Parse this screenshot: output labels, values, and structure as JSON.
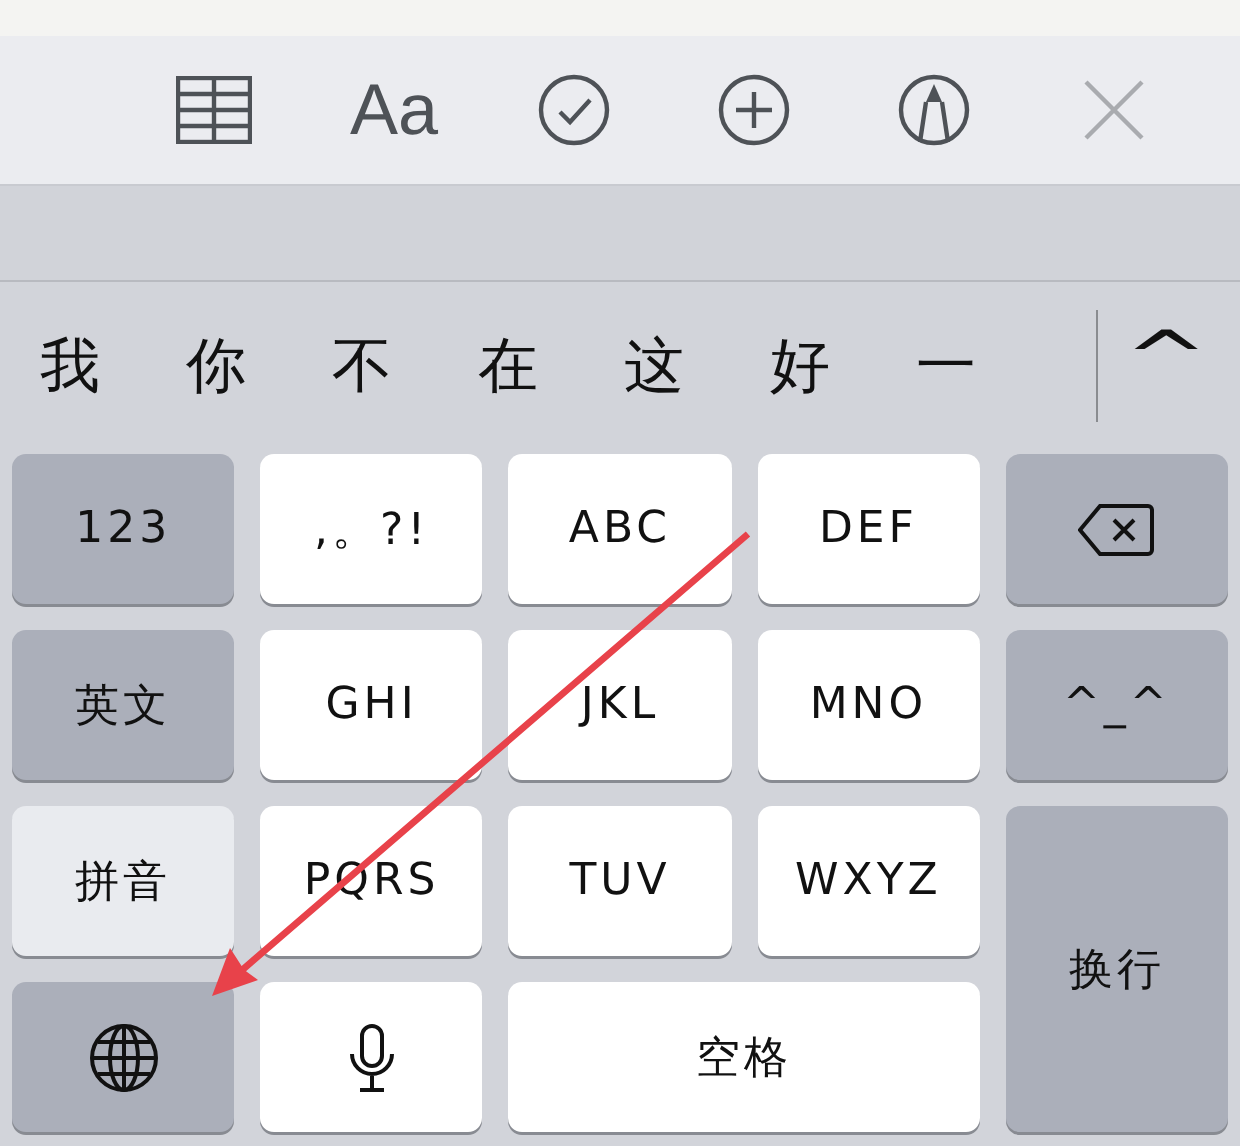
{
  "toolbar": {
    "items": [
      {
        "kind": "table"
      },
      {
        "kind": "text",
        "label": "Aa"
      },
      {
        "kind": "check"
      },
      {
        "kind": "plus"
      },
      {
        "kind": "pen"
      },
      {
        "kind": "close"
      }
    ]
  },
  "candidates": {
    "items": [
      "我",
      "你",
      "不",
      "在",
      "这",
      "好",
      "一"
    ],
    "expand": "^"
  },
  "keys": [
    {
      "kind": "function",
      "label": "123"
    },
    {
      "kind": "letter",
      "label": ",。?!"
    },
    {
      "kind": "letter",
      "label": "ABC"
    },
    {
      "kind": "letter",
      "label": "DEF"
    },
    {
      "kind": "delete"
    },
    {
      "kind": "function",
      "label": "英文",
      "selected": false
    },
    {
      "kind": "letter",
      "label": "GHI"
    },
    {
      "kind": "letter",
      "label": "JKL"
    },
    {
      "kind": "letter",
      "label": "MNO"
    },
    {
      "kind": "function",
      "label": "^_^"
    },
    {
      "kind": "function",
      "label": "拼音",
      "selected": true
    },
    {
      "kind": "letter",
      "label": "PQRS"
    },
    {
      "kind": "letter",
      "label": "TUV"
    },
    {
      "kind": "letter",
      "label": "WXYZ"
    },
    {
      "kind": "return",
      "label": "换行"
    },
    {
      "kind": "globe"
    },
    {
      "kind": "mic"
    },
    {
      "kind": "space",
      "label": "空格"
    }
  ]
}
